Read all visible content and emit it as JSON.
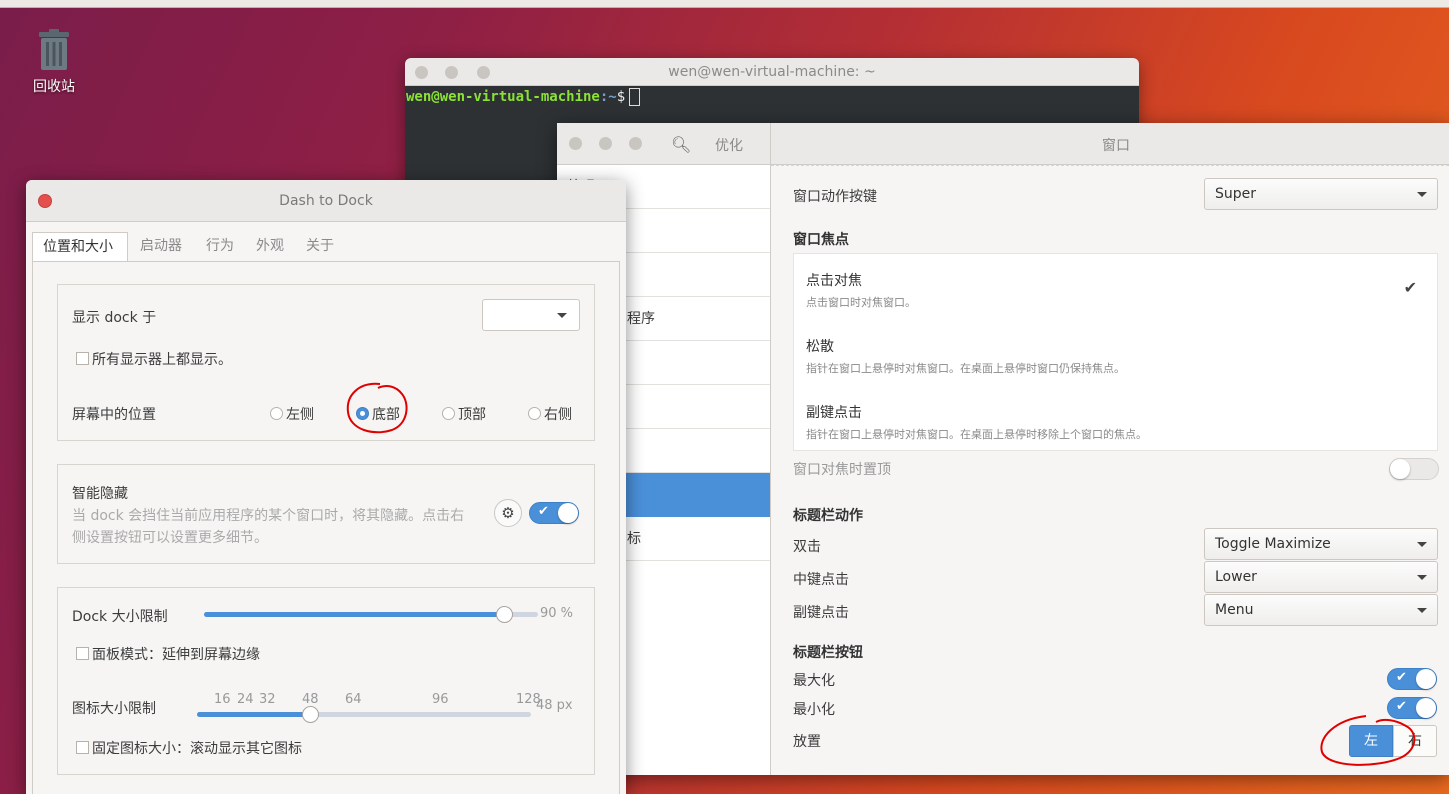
{
  "desktop": {
    "trash_label": "回收站"
  },
  "terminal": {
    "title": "wen@wen-virtual-machine: ~",
    "prompt_user": "wen@wen-virtual-machine",
    "prompt_path": ":~",
    "prompt_symbol": "$"
  },
  "tweaks": {
    "title_left": "优化",
    "title_right": "窗口",
    "sidebar": [
      {
        "label": "外观"
      },
      {
        "label": ""
      },
      {
        "label": ""
      },
      {
        "label": "程序"
      },
      {
        "label": ""
      },
      {
        "label": ""
      },
      {
        "label": ""
      },
      {
        "label": "",
        "selected": true
      },
      {
        "label": "标"
      }
    ],
    "window_action_key": {
      "label": "窗口动作按键",
      "value": "Super"
    },
    "focus": {
      "section": "窗口焦点",
      "items": [
        {
          "title": "点击对焦",
          "desc": "点击窗口时对焦窗口。",
          "checked": true
        },
        {
          "title": "松散",
          "desc": "指针在窗口上悬停时对焦窗口。在桌面上悬停时窗口仍保持焦点。"
        },
        {
          "title": "副键点击",
          "desc": "指针在窗口上悬停时对焦窗口。在桌面上悬停时移除上个窗口的焦点。"
        }
      ],
      "raise_label": "窗口对焦时置顶"
    },
    "titlebar_actions": {
      "section": "标题栏动作",
      "double_click": {
        "label": "双击",
        "value": "Toggle Maximize"
      },
      "middle_click": {
        "label": "中键点击",
        "value": "Lower"
      },
      "secondary_click": {
        "label": "副键点击",
        "value": "Menu"
      }
    },
    "titlebar_buttons": {
      "section": "标题栏按钮",
      "maximize": {
        "label": "最大化",
        "on": true
      },
      "minimize": {
        "label": "最小化",
        "on": true
      },
      "placement": {
        "label": "放置",
        "left": "左",
        "right": "右",
        "selected": "左"
      }
    }
  },
  "dock": {
    "title": "Dash to Dock",
    "tabs": [
      "位置和大小",
      "启动器",
      "行为",
      "外观",
      "关于"
    ],
    "show_on_label": "显示 dock 于",
    "show_on_value": "",
    "all_monitors": "所有显示器上都显示。",
    "position_label": "屏幕中的位置",
    "positions": [
      "左侧",
      "底部",
      "顶部",
      "右侧"
    ],
    "position_selected": "底部",
    "intellihide_title": "智能隐藏",
    "intellihide_desc": "当 dock 会挡住当前应用程序的某个窗口时，将其隐藏。点击右侧设置按钮可以设置更多细节。",
    "intellihide_on": true,
    "dock_size_label": "Dock 大小限制",
    "dock_size_value": "90 %",
    "dock_size_fraction": 0.9,
    "panel_mode": "面板模式：延伸到屏幕边缘",
    "icon_size_label": "图标大小限制",
    "icon_size_marks": [
      "16",
      "24",
      "32",
      "48",
      "64",
      "96",
      "128"
    ],
    "icon_size_value": "48 px",
    "fixed_icon_size": "固定图标大小：滚动显示其它图标"
  },
  "colors": {
    "accent": "#4a90d9",
    "annotation": "#e00000"
  }
}
